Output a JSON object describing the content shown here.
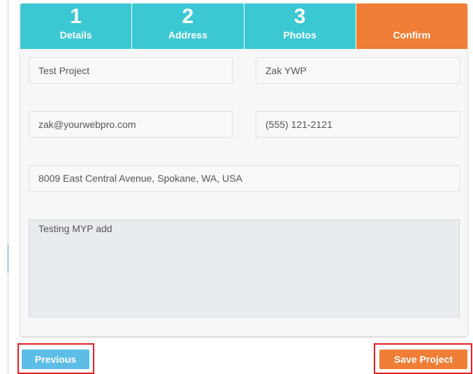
{
  "wizard": {
    "steps": [
      {
        "number": "1",
        "label": "Details",
        "active": false
      },
      {
        "number": "2",
        "label": "Address",
        "active": false
      },
      {
        "number": "3",
        "label": "Photos",
        "active": false
      },
      {
        "number": "",
        "label": "Confirm",
        "active": true
      }
    ]
  },
  "form": {
    "project_name": "Test Project",
    "contact_name": "Zak YWP",
    "email": "zak@yourwebpro.com",
    "phone": "(555) 121-2121",
    "address": "8009 East Central Avenue, Spokane, WA, USA",
    "description": "Testing MYP add"
  },
  "footer": {
    "previous_label": "Previous",
    "save_label": "Save Project"
  },
  "colors": {
    "step_teal": "#3cc8d3",
    "step_active_orange": "#f07e36",
    "previous_blue": "#5dbde6",
    "save_orange": "#f07e36",
    "highlight_red": "#e41e26"
  }
}
